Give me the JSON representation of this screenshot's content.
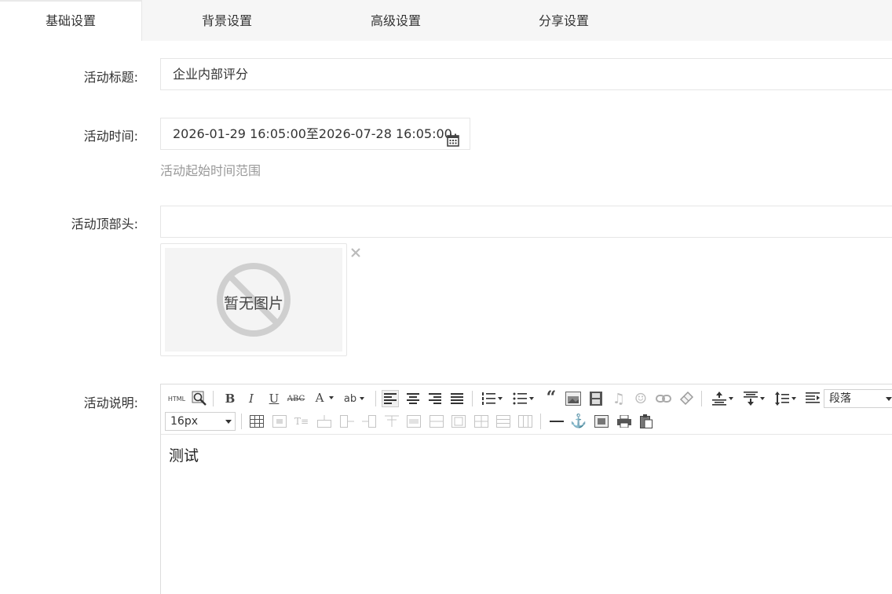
{
  "tabs": [
    "基础设置",
    "背景设置",
    "高级设置",
    "分享设置"
  ],
  "form": {
    "title_label": "活动标题:",
    "title_value": "企业内部评分",
    "time_label": "活动时间:",
    "time_value": "2026-01-29 16:05:00至2026-07-28 16:05:00",
    "time_hint": "活动起始时间范围",
    "header_label": "活动顶部头:",
    "header_value": "",
    "no_image_text": "暂无图片",
    "desc_label": "活动说明:"
  },
  "editor": {
    "paragraph_select": "段落",
    "font_size_select": "16px",
    "content": "测试",
    "toolbar_icons": [
      "html-source",
      "preview",
      "bold",
      "italic",
      "underline",
      "strikethrough",
      "font-color",
      "background-color",
      "align-left",
      "align-center",
      "align-right",
      "align-justify",
      "ordered-list",
      "unordered-list",
      "blockquote",
      "image",
      "video",
      "music",
      "emoticon",
      "link",
      "eraser",
      "row-spacing-top",
      "row-spacing-bottom",
      "line-height",
      "indent"
    ]
  },
  "colors": {
    "tab_bg": "#f6f6f6",
    "hint": "#999999",
    "border": "#e6e6e6"
  }
}
